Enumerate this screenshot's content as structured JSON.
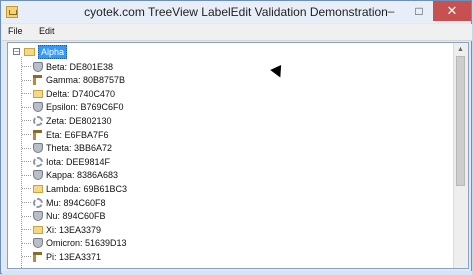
{
  "window": {
    "title": "cyotek.com TreeView LabelEdit Validation Demonstration"
  },
  "menu": {
    "file": "File",
    "edit": "Edit"
  },
  "tree": {
    "root_label": "Alpha",
    "items": [
      {
        "label": "Beta: DE801E38",
        "icon": "shield-icon"
      },
      {
        "label": "Gamma: 80B8757B",
        "icon": "hammer-icon"
      },
      {
        "label": "Delta: D740C470",
        "icon": "folder-icon"
      },
      {
        "label": "Epsilon: B769C6F0",
        "icon": "shield-icon"
      },
      {
        "label": "Zeta: DE802130",
        "icon": "gears-icon"
      },
      {
        "label": "Eta: E6FBA7F6",
        "icon": "hammer-icon"
      },
      {
        "label": "Theta: 3BB6A72",
        "icon": "shield-icon"
      },
      {
        "label": "Iota: DEE9814F",
        "icon": "gears-icon"
      },
      {
        "label": "Kappa: 8386A683",
        "icon": "shield-icon"
      },
      {
        "label": "Lambda: 69B61BC3",
        "icon": "folder-icon"
      },
      {
        "label": "Mu: 894C60F8",
        "icon": "gears-icon"
      },
      {
        "label": "Nu: 894C60FB",
        "icon": "shield-icon"
      },
      {
        "label": "Xi: 13EA3379",
        "icon": "folder-icon"
      },
      {
        "label": "Omicron: 51639D13",
        "icon": "shield-icon"
      },
      {
        "label": "Pi: 13EA3371",
        "icon": "hammer-icon"
      }
    ]
  },
  "colors": {
    "selection": "#3399ff",
    "close_button": "#c75050"
  }
}
